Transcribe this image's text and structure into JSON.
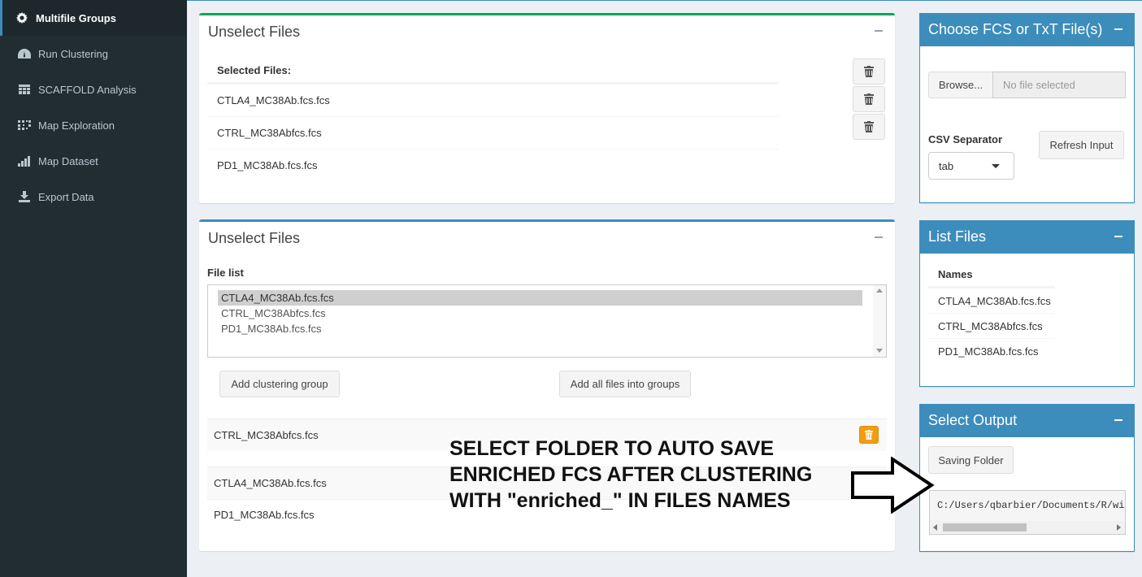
{
  "sidebar": {
    "items": [
      {
        "label": "Multifile Groups",
        "icon": "gear-icon"
      },
      {
        "label": "Run Clustering",
        "icon": "dashboard-icon"
      },
      {
        "label": "SCAFFOLD Analysis",
        "icon": "table-icon"
      },
      {
        "label": "Map Exploration",
        "icon": "dots-grid-icon"
      },
      {
        "label": "Map Dataset",
        "icon": "signal-bars-icon"
      },
      {
        "label": "Export Data",
        "icon": "download-icon"
      }
    ]
  },
  "box1": {
    "title": "Unselect Files",
    "header": "Selected Files:",
    "rows": [
      "CTLA4_MC38Ab.fcs.fcs",
      "CTRL_MC38Abfcs.fcs",
      "PD1_MC38Ab.fcs.fcs"
    ]
  },
  "box2": {
    "title": "Unselect Files",
    "file_list_label": "File list",
    "options": [
      "CTLA4_MC38Ab.fcs.fcs",
      "CTRL_MC38Abfcs.fcs",
      "PD1_MC38Ab.fcs.fcs"
    ],
    "add_group_label": "Add clustering group",
    "add_all_label": "Add all files into groups",
    "groups": [
      "CTRL_MC38Abfcs.fcs",
      "CTLA4_MC38Ab.fcs.fcs",
      "PD1_MC38Ab.fcs.fcs"
    ]
  },
  "choose": {
    "title": "Choose FCS or TxT File(s)",
    "browse_label": "Browse...",
    "file_placeholder": "No file selected",
    "csv_label": "CSV Separator",
    "csv_value": "tab",
    "refresh_label": "Refresh Input"
  },
  "list_files": {
    "title": "List Files",
    "header": "Names",
    "rows": [
      "CTLA4_MC38Ab.fcs.fcs",
      "CTRL_MC38Abfcs.fcs",
      "PD1_MC38Ab.fcs.fcs"
    ]
  },
  "output": {
    "title": "Select Output",
    "saving_label": "Saving Folder",
    "path": "C:/Users/qbarbier/Documents/R/win"
  },
  "annotation": {
    "line1": "SELECT FOLDER TO AUTO SAVE",
    "line2": "ENRICHED FCS AFTER CLUSTERING",
    "line3": "WITH \"enriched_\" IN FILES NAMES"
  },
  "colors": {
    "sidebar_bg": "#222d32",
    "primary": "#3c8dbc",
    "success": "#00a65a",
    "warning": "#f39c12"
  }
}
